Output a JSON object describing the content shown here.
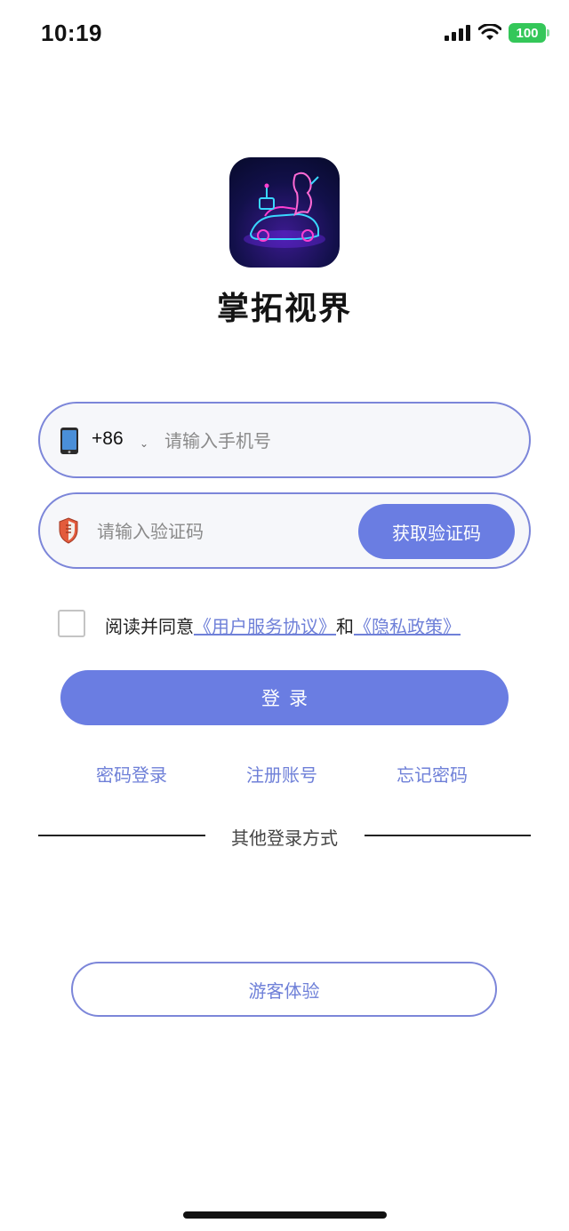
{
  "status_bar": {
    "time": "10:19",
    "battery": "100",
    "battery_color": "#34c759"
  },
  "app": {
    "name": "掌拓视界",
    "icon": "neon-robot-car-singer-icon"
  },
  "phone_field": {
    "icon": "phone-icon",
    "country_code": "+86",
    "chevron": "⌄",
    "placeholder": "请输入手机号"
  },
  "code_field": {
    "icon": "shield-icon",
    "placeholder": "请输入验证码",
    "button_label": "获取验证码"
  },
  "agreement": {
    "checked": false,
    "prefix": "阅读并同意",
    "terms_link": "《用户服务协议》",
    "conjunction": "和",
    "privacy_link": "《隐私政策》"
  },
  "login_button": "登录",
  "links": {
    "password_login": "密码登录",
    "register": "注册账号",
    "forgot_password": "忘记密码"
  },
  "other_methods": "其他登录方式",
  "guest_button": "游客体验",
  "colors": {
    "accent": "#6a7de2",
    "border": "#7c86d9",
    "link": "#6f80d8"
  }
}
